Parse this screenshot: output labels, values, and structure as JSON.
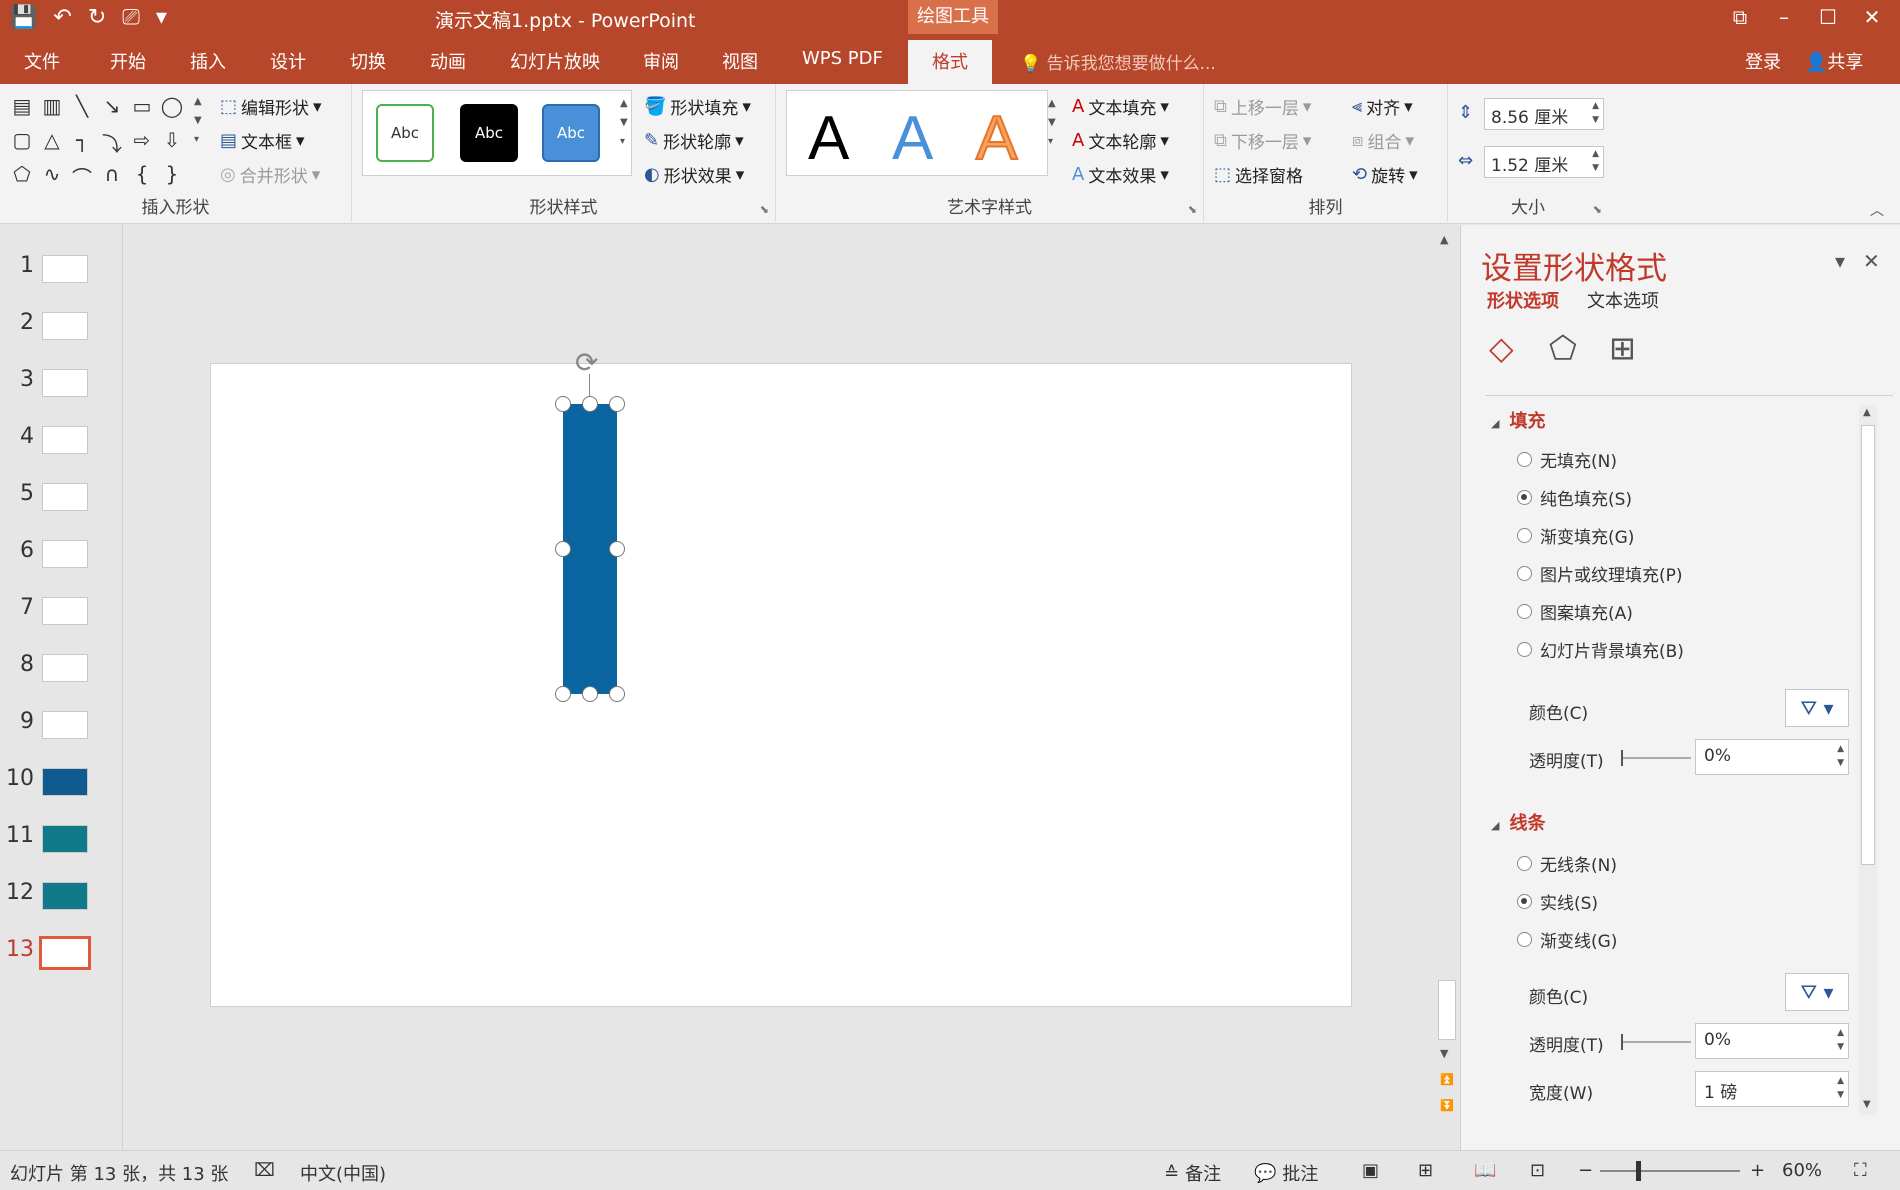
{
  "titlebar": {
    "doc_title": "演示文稿1.pptx - PowerPoint",
    "context_tab_title": "绘图工具"
  },
  "tabs": {
    "items": [
      "文件",
      "开始",
      "插入",
      "设计",
      "切换",
      "动画",
      "幻灯片放映",
      "审阅",
      "视图",
      "WPS PDF",
      "格式"
    ],
    "active": "格式",
    "tell_me": "告诉我您想要做什么...",
    "login": "登录",
    "share": "共享"
  },
  "ribbon": {
    "insert_shapes": {
      "edit_shape": "编辑形状",
      "text_box": "文本框",
      "merge_shapes": "合并形状",
      "label": "插入形状"
    },
    "shape_styles": {
      "sample": "Abc",
      "shape_fill": "形状填充",
      "shape_outline": "形状轮廓",
      "shape_effects": "形状效果",
      "label": "形状样式"
    },
    "wordart": {
      "letter": "A",
      "text_fill": "文本填充",
      "text_outline": "文本轮廓",
      "text_effects": "文本效果",
      "label": "艺术字样式"
    },
    "arrange": {
      "bring_forward": "上移一层",
      "send_backward": "下移一层",
      "selection_pane": "选择窗格",
      "align": "对齐",
      "group": "组合",
      "rotate": "旋转",
      "label": "排列"
    },
    "size": {
      "height": "8.56 厘米",
      "width": "1.52 厘米",
      "label": "大小"
    }
  },
  "slides": {
    "numbers": [
      "1",
      "2",
      "3",
      "4",
      "5",
      "6",
      "7",
      "8",
      "9",
      "10",
      "11",
      "12",
      "13"
    ],
    "active": "13"
  },
  "format_pane": {
    "title": "设置形状格式",
    "tab_shape": "形状选项",
    "tab_text": "文本选项",
    "fill": {
      "heading": "填充",
      "options": [
        "无填充(N)",
        "纯色填充(S)",
        "渐变填充(G)",
        "图片或纹理填充(P)",
        "图案填充(A)",
        "幻灯片背景填充(B)"
      ],
      "selected": "纯色填充(S)",
      "color_label": "颜色(C)",
      "transparency_label": "透明度(T)",
      "transparency": "0%"
    },
    "line": {
      "heading": "线条",
      "options": [
        "无线条(N)",
        "实线(S)",
        "渐变线(G)"
      ],
      "selected": "实线(S)",
      "color_label": "颜色(C)",
      "transparency_label": "透明度(T)",
      "transparency": "0%",
      "width_label": "宽度(W)",
      "width": "1 磅"
    }
  },
  "statusbar": {
    "slide_info": "幻灯片 第 13 张，共 13 张",
    "language": "中文(中国)",
    "notes": "备注",
    "comments": "批注",
    "zoom": "60%"
  },
  "colors": {
    "accent": "#b7472a",
    "shape_fill": "#0a64a0",
    "highlight": "#c0392b"
  }
}
